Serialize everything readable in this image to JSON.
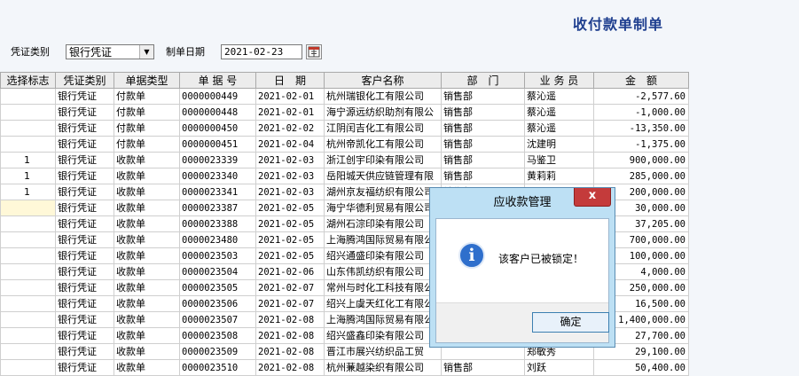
{
  "title": "收付款单制单",
  "filters": {
    "voucher_type_label": "凭证类别",
    "voucher_type_value": "银行凭证",
    "date_label": "制单日期",
    "date_value": "2021-02-23"
  },
  "icons": {
    "dropdown": "chevron-down-icon",
    "calendar": "calendar-icon",
    "info": "info-icon",
    "close": "close-icon"
  },
  "columns": [
    "选择标志",
    "凭证类别",
    "单据类型",
    "单 据 号",
    "日　期",
    "客户名称",
    "部　门",
    "业 务 员",
    "金　额"
  ],
  "rows": [
    [
      "",
      "银行凭证",
      "付款单",
      "0000000449",
      "2021-02-01",
      "杭州瑞银化工有限公司",
      "销售部",
      "蔡沁遥",
      "-2,577.60"
    ],
    [
      "",
      "银行凭证",
      "付款单",
      "0000000448",
      "2021-02-01",
      "海宁源远纺织助剂有限公",
      "销售部",
      "蔡沁遥",
      "-1,000.00"
    ],
    [
      "",
      "银行凭证",
      "付款单",
      "0000000450",
      "2021-02-02",
      "江阴闰吉化工有限公司",
      "销售部",
      "蔡沁遥",
      "-13,350.00"
    ],
    [
      "",
      "银行凭证",
      "付款单",
      "0000000451",
      "2021-02-04",
      "杭州帝凯化工有限公司",
      "销售部",
      "沈建明",
      "-1,375.00"
    ],
    [
      "1",
      "银行凭证",
      "收款单",
      "0000023339",
      "2021-02-03",
      "浙江创宇印染有限公司",
      "销售部",
      "马鉴卫",
      "900,000.00"
    ],
    [
      "1",
      "银行凭证",
      "收款单",
      "0000023340",
      "2021-02-03",
      "岳阳城天供应链管理有限",
      "销售部",
      "黄莉莉",
      "285,000.00"
    ],
    [
      "1",
      "银行凭证",
      "收款单",
      "0000023341",
      "2021-02-03",
      "湖州京友福纺织有限公司",
      "销售部",
      "",
      "200,000.00"
    ],
    [
      "",
      "银行凭证",
      "收款单",
      "0000023387",
      "2021-02-05",
      "海宁华德利贸易有限公司",
      "",
      "",
      "30,000.00"
    ],
    [
      "",
      "银行凭证",
      "收款单",
      "0000023388",
      "2021-02-05",
      "湖州石淙印染有限公司",
      "",
      "",
      "37,205.00"
    ],
    [
      "",
      "银行凭证",
      "收款单",
      "0000023480",
      "2021-02-05",
      "上海腾鸿国际贸易有限公司",
      "",
      "",
      "700,000.00"
    ],
    [
      "",
      "银行凭证",
      "收款单",
      "0000023503",
      "2021-02-05",
      "绍兴通盛印染有限公司",
      "",
      "",
      "100,000.00"
    ],
    [
      "",
      "银行凭证",
      "收款单",
      "0000023504",
      "2021-02-06",
      "山东伟凯纺织有限公司",
      "",
      "",
      "4,000.00"
    ],
    [
      "",
      "银行凭证",
      "收款单",
      "0000023505",
      "2021-02-07",
      "常州与时化工科技有限公司",
      "",
      "",
      "250,000.00"
    ],
    [
      "",
      "银行凭证",
      "收款单",
      "0000023506",
      "2021-02-07",
      "绍兴上虞天红化工有限公司",
      "",
      "",
      "16,500.00"
    ],
    [
      "",
      "银行凭证",
      "收款单",
      "0000023507",
      "2021-02-08",
      "上海腾鸿国际贸易有限公司",
      "",
      "",
      "1,400,000.00"
    ],
    [
      "",
      "银行凭证",
      "收款单",
      "0000023508",
      "2021-02-08",
      "绍兴盛鑫印染有限公司",
      "",
      "",
      "27,700.00"
    ],
    [
      "",
      "银行凭证",
      "收款单",
      "0000023509",
      "2021-02-08",
      "晋江市展兴纺织品工贸",
      "",
      "郑敏秀",
      "29,100.00"
    ],
    [
      "",
      "银行凭证",
      "收款单",
      "0000023510",
      "2021-02-08",
      "杭州蒹越染织有限公司",
      "销售部",
      "刘跃",
      "50,400.00"
    ]
  ],
  "dialog": {
    "title": "应收款管理",
    "close_label": "x",
    "message": "该客户已被锁定！",
    "ok_label": "确定"
  }
}
